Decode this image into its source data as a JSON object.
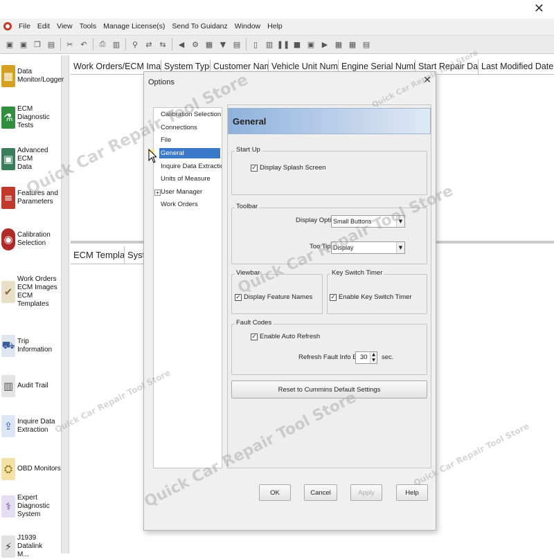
{
  "window": {
    "close_glyph": "✕"
  },
  "menubar": {
    "items": [
      "File",
      "Edit",
      "View",
      "Tools",
      "Manage License(s)",
      "Send To Guidanz",
      "Window",
      "Help"
    ]
  },
  "toolbar": {
    "icons": [
      "save-icon",
      "save-as-icon",
      "copy-icon",
      "paste-icon",
      "cut-icon",
      "undo-icon",
      "print-icon",
      "print-preview-icon",
      "find-icon",
      "connect-icon",
      "disconnect-icon",
      "settings-icon",
      "filter-icon",
      "monitor-icon",
      "pause-icon",
      "stop-icon",
      "record-icon",
      "playback-icon"
    ]
  },
  "sidebar": {
    "items": [
      {
        "label": "Data\nMonitor/Logger",
        "icon": "data-monitor-icon",
        "color": "#d6a020"
      },
      {
        "label": "ECM Diagnostic\nTests",
        "icon": "ecm-diagnostic-icon",
        "color": "#2f8f3f"
      },
      {
        "label": "Advanced ECM\nData",
        "icon": "advanced-ecm-icon",
        "color": "#3a7d5a"
      },
      {
        "label": "Features and\nParameters",
        "icon": "features-icon",
        "color": "#c0392b"
      },
      {
        "label": "Calibration\nSelection",
        "icon": "calibration-icon",
        "color": "#b02a2a"
      },
      {
        "label": "Work Orders\nECM Images\nECM Templates",
        "icon": "work-orders-icon",
        "color": "#8a6d3b"
      },
      {
        "label": "Trip Information",
        "icon": "trip-icon",
        "color": "#3b5b9a"
      },
      {
        "label": "Audit Trail",
        "icon": "audit-trail-icon",
        "color": "#555555"
      },
      {
        "label": "Inquire Data\nExtraction",
        "icon": "inquire-icon",
        "color": "#2b5fa8"
      },
      {
        "label": "OBD Monitors",
        "icon": "obd-icon",
        "color": "#d4a017"
      },
      {
        "label": "Expert\nDiagnostic\nSystem",
        "icon": "expert-icon",
        "color": "#6a4c93"
      },
      {
        "label": "J1939 Datalink\nM...",
        "icon": "j1939-icon",
        "color": "#444444"
      }
    ]
  },
  "grid_top": {
    "columns": [
      "Work Orders/ECM Images",
      "System Type",
      "Customer Name",
      "Vehicle Unit Number",
      "Engine Serial Number",
      "Start Repair Date",
      "Last Modified Date"
    ]
  },
  "grid_bottom": {
    "columns": [
      "ECM Template",
      "Syste"
    ]
  },
  "dialog": {
    "title": "Options",
    "close_glyph": "✕",
    "tree": [
      {
        "label": "Calibration Selection",
        "selected": false
      },
      {
        "label": "Connections",
        "selected": false
      },
      {
        "label": "File",
        "selected": false
      },
      {
        "label": "General",
        "selected": true
      },
      {
        "label": "Inquire Data Extraction",
        "selected": false
      },
      {
        "label": "Units of Measure",
        "selected": false
      },
      {
        "label": "User Manager",
        "selected": false,
        "expander": "+"
      },
      {
        "label": "Work Orders",
        "selected": false
      }
    ],
    "header": "General",
    "startup": {
      "legend": "Start Up",
      "display_splash": {
        "label": "Display Splash Screen",
        "checked": true
      }
    },
    "toolbar_group": {
      "legend": "Toolbar",
      "display_options_label": "Display Options",
      "display_options_value": "Small Buttons",
      "tips_label": "Too  Tips",
      "tips_value": "Display"
    },
    "viewbar": {
      "legend": "Viewbar",
      "display_feature_names": {
        "label": "Display Feature Names",
        "checked": true
      }
    },
    "keyswitch": {
      "legend": "Key Switch Timer",
      "enable": {
        "label": "Enable Key Switch Timer",
        "checked": true
      }
    },
    "fault_codes": {
      "legend": "Fault Codes",
      "auto_refresh": {
        "label": "Enable Auto Refresh",
        "checked": true
      },
      "refresh_label": "Refresh Fault Info Every",
      "refresh_value": "30",
      "unit": "sec."
    },
    "reset_label": "Reset to Cummins Default Settings",
    "buttons": {
      "ok": "OK",
      "cancel": "Cancel",
      "apply": "Apply",
      "help": "Help"
    }
  },
  "watermark": {
    "text_large": "Quick Car Repair Tool Store",
    "text_small": "Quick Car Repair Tool Store"
  }
}
